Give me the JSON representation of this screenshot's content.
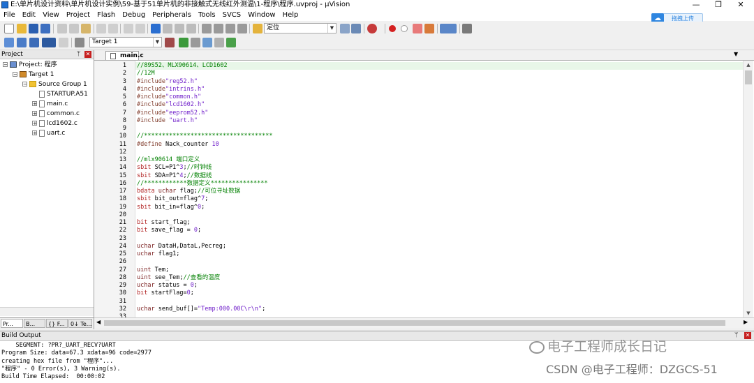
{
  "window": {
    "title": "E:\\单片机设计资料\\单片机设计实例\\59-基于51单片机的非接触式无线红外测温\\1-程序\\程序.uvproj - µVision",
    "controls": [
      "—",
      "❐",
      "✕"
    ]
  },
  "menu": [
    "File",
    "Edit",
    "View",
    "Project",
    "Flash",
    "Debug",
    "Peripherals",
    "Tools",
    "SVCS",
    "Window",
    "Help"
  ],
  "upload_button": {
    "label": "拖拽上传"
  },
  "toolbar1": {
    "find_combo": "定位"
  },
  "toolbar2": {
    "target_combo": "Target 1"
  },
  "project_panel": {
    "title": "Project",
    "tree": [
      {
        "label": "Project: 程序",
        "icon": "project-icon",
        "expander": "−"
      },
      {
        "label": "Target 1",
        "icon": "target-icon",
        "expander": "−"
      },
      {
        "label": "Source Group 1",
        "icon": "folder-icon",
        "expander": "−"
      },
      {
        "label": "STARTUP.A51",
        "icon": "file-icon",
        "expander": ""
      },
      {
        "label": "main.c",
        "icon": "file-icon",
        "expander": "+"
      },
      {
        "label": "common.c",
        "icon": "file-icon",
        "expander": "+"
      },
      {
        "label": "lcd1602.c",
        "icon": "file-icon",
        "expander": "+"
      },
      {
        "label": "uart.c",
        "icon": "file-icon",
        "expander": "+"
      }
    ],
    "tabs": [
      "Pr...",
      "B...",
      "{} F...",
      "0↓ Te..."
    ]
  },
  "editor": {
    "tab": "main.c",
    "lines": [
      [
        [
          "cm",
          "//89S52、MLX90614、LCD1602"
        ]
      ],
      [
        [
          "cm",
          "//12M"
        ]
      ],
      [
        [
          "pp",
          "#include"
        ],
        [
          "str",
          "\"reg52.h\""
        ]
      ],
      [
        [
          "pp",
          "#include"
        ],
        [
          "str",
          "\"intrins.h\""
        ]
      ],
      [
        [
          "pp",
          "#include"
        ],
        [
          "str",
          "\"common.h\""
        ]
      ],
      [
        [
          "pp",
          "#include"
        ],
        [
          "str",
          "\"lcd1602.h\""
        ]
      ],
      [
        [
          "pp",
          "#include"
        ],
        [
          "str",
          "\"eeprom52.h\""
        ]
      ],
      [
        [
          "pp",
          "#include "
        ],
        [
          "str",
          "\"uart.h\""
        ]
      ],
      [
        [
          "t",
          ""
        ]
      ],
      [
        [
          "cm",
          "//************************************"
        ]
      ],
      [
        [
          "pp",
          "#define "
        ],
        [
          "t",
          "Nack_counter "
        ],
        [
          "num",
          "10"
        ]
      ],
      [
        [
          "t",
          ""
        ]
      ],
      [
        [
          "cm",
          "//mlx90614 端口定义"
        ]
      ],
      [
        [
          "kw",
          "sbit "
        ],
        [
          "t",
          "SCL=P1^"
        ],
        [
          "num",
          "3"
        ],
        [
          "t",
          ";"
        ],
        [
          "cm",
          "//时钟线"
        ]
      ],
      [
        [
          "kw",
          "sbit "
        ],
        [
          "t",
          "SDA=P1^"
        ],
        [
          "num",
          "4"
        ],
        [
          "t",
          ";"
        ],
        [
          "cm",
          "//数据线"
        ]
      ],
      [
        [
          "cm",
          "//************数据定义****************"
        ]
      ],
      [
        [
          "kw",
          "bdata "
        ],
        [
          "ty",
          "uchar "
        ],
        [
          "t",
          "flag;"
        ],
        [
          "cm",
          "//可位寻址数据"
        ]
      ],
      [
        [
          "kw",
          "sbit "
        ],
        [
          "t",
          "bit_out=flag^"
        ],
        [
          "num",
          "7"
        ],
        [
          "t",
          ";"
        ]
      ],
      [
        [
          "kw",
          "sbit "
        ],
        [
          "t",
          "bit_in=flag^"
        ],
        [
          "num",
          "0"
        ],
        [
          "t",
          ";"
        ]
      ],
      [
        [
          "t",
          ""
        ]
      ],
      [
        [
          "kw",
          "bit "
        ],
        [
          "t",
          "start_flag;"
        ]
      ],
      [
        [
          "kw",
          "bit "
        ],
        [
          "t",
          "save_flag = "
        ],
        [
          "num",
          "0"
        ],
        [
          "t",
          ";"
        ]
      ],
      [
        [
          "t",
          ""
        ]
      ],
      [
        [
          "ty",
          "uchar "
        ],
        [
          "t",
          "DataH,DataL,Pecreg;"
        ]
      ],
      [
        [
          "ty",
          "uchar "
        ],
        [
          "t",
          "flag1;"
        ]
      ],
      [
        [
          "t",
          ""
        ]
      ],
      [
        [
          "ty",
          "uint "
        ],
        [
          "t",
          "Tem;"
        ]
      ],
      [
        [
          "ty",
          "uint "
        ],
        [
          "t",
          "see_Tem;"
        ],
        [
          "cm",
          "//查看的温度"
        ]
      ],
      [
        [
          "ty",
          "uchar "
        ],
        [
          "t",
          "status = "
        ],
        [
          "num",
          "0"
        ],
        [
          "t",
          ";"
        ]
      ],
      [
        [
          "kw",
          "bit "
        ],
        [
          "t",
          "startFlag="
        ],
        [
          "num",
          "0"
        ],
        [
          "t",
          ";"
        ]
      ],
      [
        [
          "t",
          ""
        ]
      ],
      [
        [
          "ty",
          "uchar "
        ],
        [
          "t",
          "send_buf[]="
        ],
        [
          "str",
          "\"Temp:000.00C\\r\\n\""
        ],
        [
          "t",
          ";"
        ]
      ],
      [
        [
          "t",
          ""
        ]
      ]
    ]
  },
  "build_output": {
    "title": "Build Output",
    "lines": [
      "    SEGMENT: ?PR?_UART_RECV?UART",
      "Program Size: data=67.3 xdata=96 code=2977",
      "creating hex file from \"程序\"...",
      "\"程序\" - 0 Error(s), 3 Warning(s).",
      "Build Time Elapsed:  00:00:02"
    ]
  },
  "watermark": {
    "line1": "电子工程师成长日记",
    "line2": "CSDN @电子工程师：DZGCS-51"
  }
}
